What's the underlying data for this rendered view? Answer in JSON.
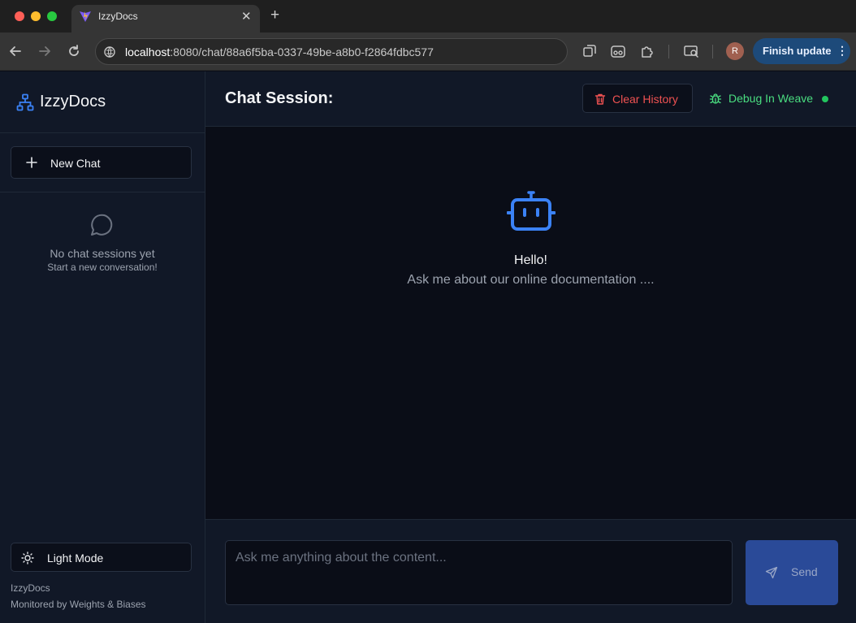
{
  "browser": {
    "tab_title": "IzzyDocs",
    "url_host": "localhost",
    "url_rest": ":8080/chat/88a6f5ba-0337-49be-a8b0-f2864fdbc577",
    "profile_initial": "R",
    "update_button": "Finish update"
  },
  "sidebar": {
    "brand": "IzzyDocs",
    "new_chat_label": "New Chat",
    "empty_title": "No chat sessions yet",
    "empty_subtitle": "Start a new conversation!",
    "theme_toggle_label": "Light Mode",
    "footer_app": "IzzyDocs",
    "footer_monitor": "Monitored by Weights & Biases"
  },
  "header": {
    "title": "Chat Session:",
    "clear_label": "Clear History",
    "debug_label": "Debug In Weave"
  },
  "welcome": {
    "greeting": "Hello!",
    "prompt": "Ask me about our online documentation ...."
  },
  "composer": {
    "placeholder": "Ask me anything about the content...",
    "send_label": "Send"
  },
  "colors": {
    "accent_blue": "#3b82f6",
    "danger_red": "#f05252",
    "status_green": "#22c55e"
  }
}
